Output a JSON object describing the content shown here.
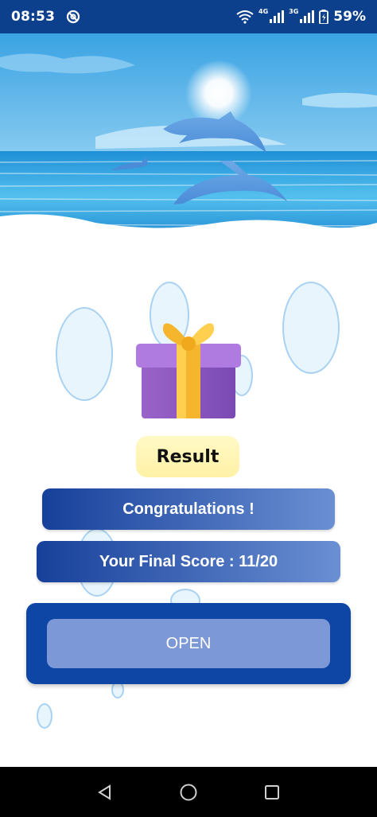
{
  "status_bar": {
    "time": "08:53",
    "network_1": "4G",
    "network_2": "3G",
    "battery": "59%",
    "app_icon": "at-sign-icon"
  },
  "result": {
    "label": "Result"
  },
  "messages": {
    "congrats": "Congratulations !",
    "score": "Your Final Score : 11/20"
  },
  "actions": {
    "open_label": "OPEN"
  },
  "colors": {
    "status_bar": "#0c3f8c",
    "bar_start": "#17409a",
    "bar_end": "#6a8fd3",
    "open_frame": "#0e46a5",
    "open_button": "#7c98d6",
    "result_pill": "#fff4b0"
  },
  "icons": {
    "header": "ocean-dolphins-illustration",
    "gift": "gift-box-icon",
    "nav_back": "back-triangle-icon",
    "nav_home": "home-circle-icon",
    "nav_recents": "recents-square-icon"
  }
}
